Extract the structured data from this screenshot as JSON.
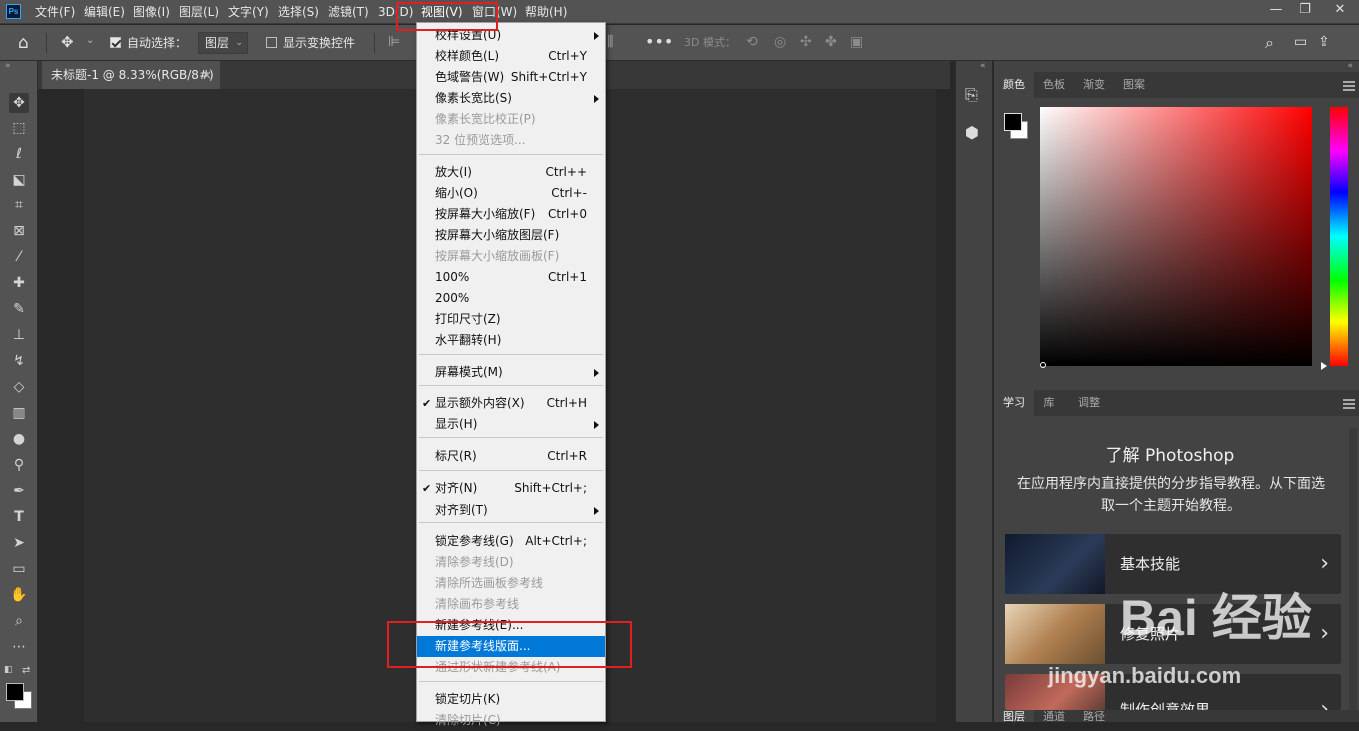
{
  "app": {
    "logo_text": "Ps"
  },
  "menubar": {
    "items": [
      "文件(F)",
      "编辑(E)",
      "图像(I)",
      "图层(L)",
      "文字(Y)",
      "选择(S)",
      "滤镜(T)",
      "3D(D)",
      "视图(V)",
      "窗口(W)",
      "帮助(H)"
    ],
    "window_controls": {
      "minimize": "—",
      "restore": "❐",
      "close": "✕"
    }
  },
  "options_bar": {
    "auto_select_label": "自动选择：",
    "auto_select_checked": true,
    "layer_select_value": "图层",
    "show_transform_label": "显示变换控件",
    "show_transform_checked": false,
    "mode_3d_label": "3D 模式："
  },
  "document": {
    "tab_title": "未标题-1 @ 8.33%(RGB/8#)",
    "close": "×"
  },
  "color_panel": {
    "tabs": [
      "颜色",
      "色板",
      "渐变",
      "图案"
    ],
    "active_tab": "颜色",
    "foreground": "#000000",
    "background": "#ffffff"
  },
  "learn_panel": {
    "tabs": [
      "学习",
      "库",
      "调整"
    ],
    "active_tab": "学习",
    "heading": "了解 Photoshop",
    "description": "在应用程序内直接提供的分步指导教程。从下面选取一个主题开始教程。",
    "cards": [
      {
        "title": "基本技能",
        "thumb_color": "#1d2a3f"
      },
      {
        "title": "修复照片",
        "thumb_color": "#b9a78a"
      },
      {
        "title": "制作创意效果",
        "thumb_color": "#6e3a3a"
      }
    ]
  },
  "bottom_tabs": [
    "图层",
    "通道",
    "路径"
  ],
  "view_menu": {
    "items": [
      {
        "label": "校样设置(U)",
        "shortcut": "",
        "submenu": true,
        "disabled": false,
        "checked": false
      },
      {
        "label": "校样颜色(L)",
        "shortcut": "Ctrl+Y",
        "submenu": false,
        "disabled": false,
        "checked": false
      },
      {
        "label": "色域警告(W)",
        "shortcut": "Shift+Ctrl+Y",
        "submenu": false,
        "disabled": false,
        "checked": false
      },
      {
        "label": "像素长宽比(S)",
        "shortcut": "",
        "submenu": true,
        "disabled": false,
        "checked": false
      },
      {
        "label": "像素长宽比校正(P)",
        "shortcut": "",
        "submenu": false,
        "disabled": true,
        "checked": false
      },
      {
        "label": "32 位预览选项...",
        "shortcut": "",
        "submenu": false,
        "disabled": true,
        "checked": false
      },
      {
        "label": "放大(I)",
        "shortcut": "Ctrl++",
        "submenu": false,
        "disabled": false,
        "checked": false
      },
      {
        "label": "缩小(O)",
        "shortcut": "Ctrl+-",
        "submenu": false,
        "disabled": false,
        "checked": false
      },
      {
        "label": "按屏幕大小缩放(F)",
        "shortcut": "Ctrl+0",
        "submenu": false,
        "disabled": false,
        "checked": false
      },
      {
        "label": "按屏幕大小缩放图层(F)",
        "shortcut": "",
        "submenu": false,
        "disabled": false,
        "checked": false
      },
      {
        "label": "按屏幕大小缩放画板(F)",
        "shortcut": "",
        "submenu": false,
        "disabled": true,
        "checked": false
      },
      {
        "label": "100%",
        "shortcut": "Ctrl+1",
        "submenu": false,
        "disabled": false,
        "checked": false
      },
      {
        "label": "200%",
        "shortcut": "",
        "submenu": false,
        "disabled": false,
        "checked": false
      },
      {
        "label": "打印尺寸(Z)",
        "shortcut": "",
        "submenu": false,
        "disabled": false,
        "checked": false
      },
      {
        "label": "水平翻转(H)",
        "shortcut": "",
        "submenu": false,
        "disabled": false,
        "checked": false
      },
      {
        "label": "屏幕模式(M)",
        "shortcut": "",
        "submenu": true,
        "disabled": false,
        "checked": false
      },
      {
        "label": "显示额外内容(X)",
        "shortcut": "Ctrl+H",
        "submenu": false,
        "disabled": false,
        "checked": true
      },
      {
        "label": "显示(H)",
        "shortcut": "",
        "submenu": true,
        "disabled": false,
        "checked": false
      },
      {
        "label": "标尺(R)",
        "shortcut": "Ctrl+R",
        "submenu": false,
        "disabled": false,
        "checked": false
      },
      {
        "label": "对齐(N)",
        "shortcut": "Shift+Ctrl+;",
        "submenu": false,
        "disabled": false,
        "checked": true
      },
      {
        "label": "对齐到(T)",
        "shortcut": "",
        "submenu": true,
        "disabled": false,
        "checked": false
      },
      {
        "label": "锁定参考线(G)",
        "shortcut": "Alt+Ctrl+;",
        "submenu": false,
        "disabled": false,
        "checked": false
      },
      {
        "label": "清除参考线(D)",
        "shortcut": "",
        "submenu": false,
        "disabled": true,
        "checked": false
      },
      {
        "label": "清除所选画板参考线",
        "shortcut": "",
        "submenu": false,
        "disabled": true,
        "checked": false
      },
      {
        "label": "清除画布参考线",
        "shortcut": "",
        "submenu": false,
        "disabled": true,
        "checked": false
      },
      {
        "label": "新建参考线(E)...",
        "shortcut": "",
        "submenu": false,
        "disabled": false,
        "checked": false
      },
      {
        "label": "新建参考线版面...",
        "shortcut": "",
        "submenu": false,
        "disabled": false,
        "checked": false,
        "highlighted": true
      },
      {
        "label": "通过形状新建参考线(A)",
        "shortcut": "",
        "submenu": false,
        "disabled": true,
        "checked": false
      },
      {
        "label": "锁定切片(K)",
        "shortcut": "",
        "submenu": false,
        "disabled": false,
        "checked": false
      },
      {
        "label": "清除切片(C)",
        "shortcut": "",
        "submenu": false,
        "disabled": true,
        "checked": false
      }
    ]
  },
  "watermark": {
    "brand": "Bai 经验",
    "url": "jingyan.baidu.com"
  }
}
